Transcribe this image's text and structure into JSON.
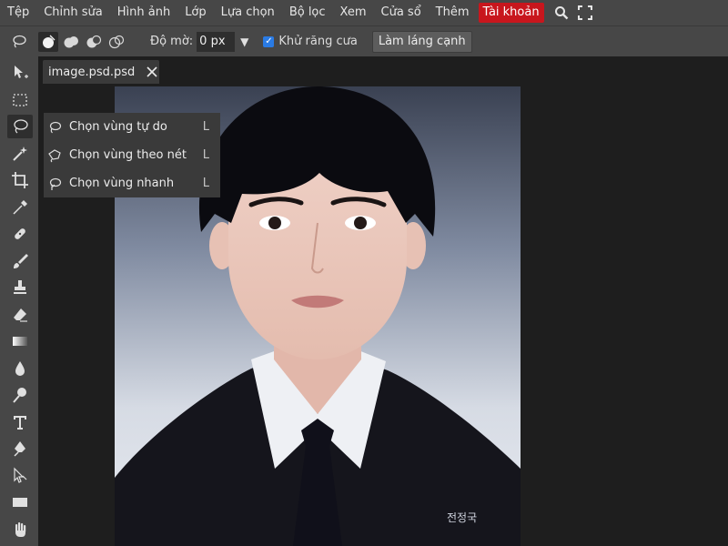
{
  "menubar": {
    "items": [
      "Tệp",
      "Chỉnh sửa",
      "Hình ảnh",
      "Lớp",
      "Lựa chọn",
      "Bộ lọc",
      "Xem",
      "Cửa sổ",
      "Thêm"
    ],
    "account_label": "Tài khoản",
    "account_color": "#c8161d",
    "icons": [
      "search-icon",
      "fullscreen-icon"
    ]
  },
  "options": {
    "feather_label": "Độ mờ:",
    "feather_value": "0 px",
    "antialias_label": "Khử răng cưa",
    "antialias_checked": true,
    "refine_edge_label": "Làm láng cạnh"
  },
  "document": {
    "tab_label": "image.psd.psd"
  },
  "lasso_menu": {
    "items": [
      {
        "label": "Chọn vùng tự do",
        "shortcut": "L",
        "icon": "lasso-icon"
      },
      {
        "label": "Chọn vùng theo nét",
        "shortcut": "L",
        "icon": "polygonal-lasso-icon"
      },
      {
        "label": "Chọn vùng nhanh",
        "shortcut": "L",
        "icon": "magnetic-lasso-icon"
      }
    ]
  },
  "photo": {
    "signature_text": "전정국"
  },
  "tools": [
    "move-tool",
    "marquee-tool",
    "lasso-tool",
    "magic-wand-tool",
    "crop-tool",
    "eyedropper-tool",
    "healing-brush-tool",
    "brush-tool",
    "clone-stamp-tool",
    "eraser-tool",
    "gradient-tool",
    "blur-tool",
    "dodge-tool",
    "type-tool",
    "pen-tool",
    "path-selection-tool",
    "shape-tool",
    "hand-tool"
  ]
}
